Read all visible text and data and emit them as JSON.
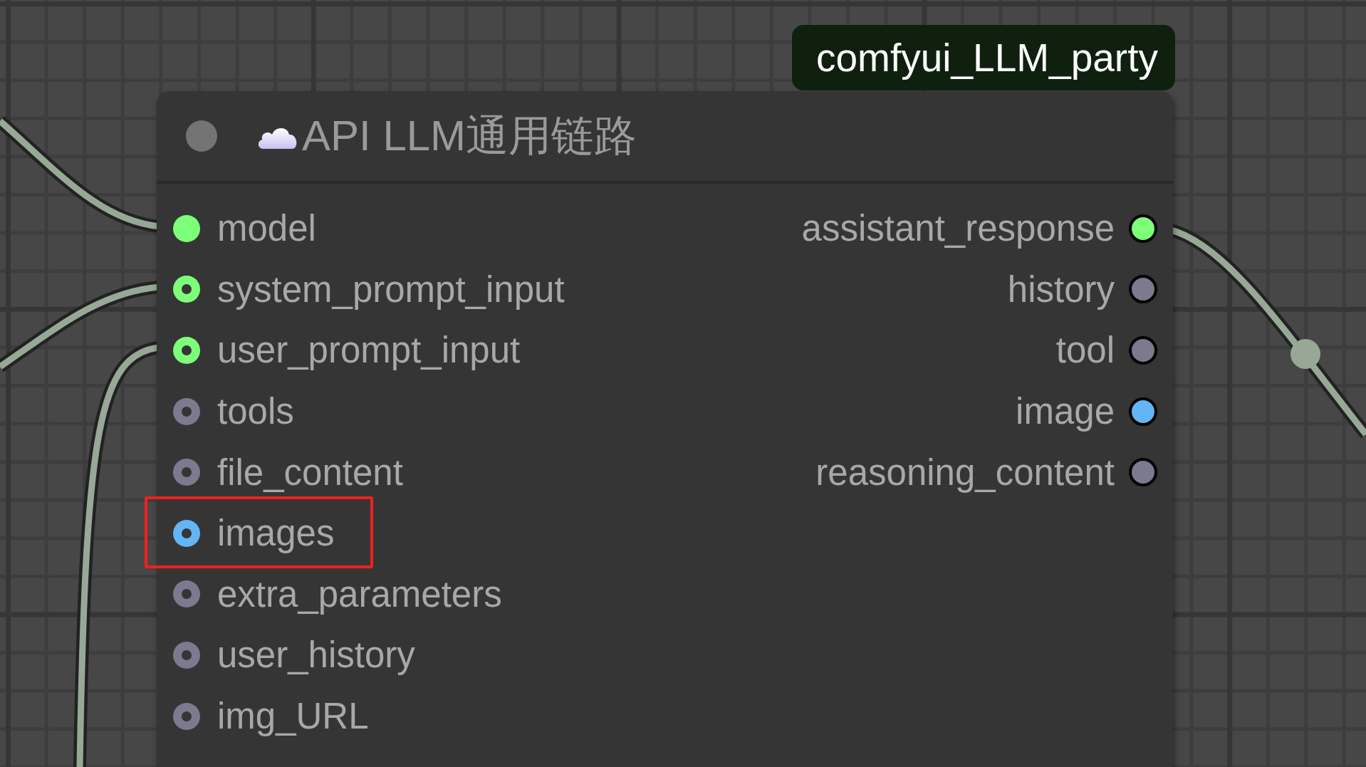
{
  "tag": {
    "text": "comfyui_LLM_party"
  },
  "node": {
    "title": "API LLM通用链路",
    "inputs": [
      {
        "label": "model",
        "color": "#7dff7a",
        "kind": "filled",
        "highlighted": false
      },
      {
        "label": "system_prompt_input",
        "color": "#7dff7a",
        "kind": "ring",
        "highlighted": false
      },
      {
        "label": "user_prompt_input",
        "color": "#7dff7a",
        "kind": "ring",
        "highlighted": false
      },
      {
        "label": "tools",
        "color": "#7b7a8f",
        "kind": "ring",
        "highlighted": false
      },
      {
        "label": "file_content",
        "color": "#7b7a8f",
        "kind": "ring",
        "highlighted": false
      },
      {
        "label": "images",
        "color": "#64b5f6",
        "kind": "ring",
        "highlighted": true
      },
      {
        "label": "extra_parameters",
        "color": "#7b7a8f",
        "kind": "ring",
        "highlighted": false
      },
      {
        "label": "user_history",
        "color": "#7b7a8f",
        "kind": "ring",
        "highlighted": false
      },
      {
        "label": "img_URL",
        "color": "#7b7a8f",
        "kind": "ring",
        "highlighted": false
      }
    ],
    "outputs": [
      {
        "label": "assistant_response",
        "color": "#7dff7a"
      },
      {
        "label": "history",
        "color": "#7b7a8f"
      },
      {
        "label": "tool",
        "color": "#7b7a8f"
      },
      {
        "label": "image",
        "color": "#64b5f6"
      },
      {
        "label": "reasoning_content",
        "color": "#7b7a8f"
      }
    ]
  }
}
